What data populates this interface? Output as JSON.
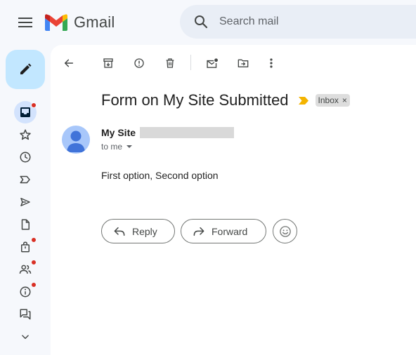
{
  "app": {
    "name": "Gmail"
  },
  "search": {
    "placeholder": "Search mail"
  },
  "sidebar": {
    "items": [
      {
        "icon": "inbox-icon",
        "badge": true,
        "active": true
      },
      {
        "icon": "star-icon",
        "badge": false
      },
      {
        "icon": "clock-icon",
        "badge": false
      },
      {
        "icon": "label-important-icon",
        "badge": false
      },
      {
        "icon": "send-icon",
        "badge": false
      },
      {
        "icon": "draft-icon",
        "badge": false
      },
      {
        "icon": "shopping-bag-icon",
        "badge": true
      },
      {
        "icon": "people-icon",
        "badge": true
      },
      {
        "icon": "info-icon",
        "badge": true
      },
      {
        "icon": "forum-icon",
        "badge": false
      },
      {
        "icon": "chevron-down-icon",
        "badge": false
      }
    ]
  },
  "email": {
    "subject": "Form on My Site Submitted",
    "label": "Inbox",
    "label_close": "×",
    "sender_name": "My Site",
    "recipient": "to me",
    "body": "First option, Second option"
  },
  "actions": {
    "reply_label": "Reply",
    "forward_label": "Forward"
  },
  "colors": {
    "compose_bg": "#c2e7ff",
    "active_nav_bg": "#d3e3fd",
    "badge": "#d93025",
    "importance": "#f4b400"
  }
}
